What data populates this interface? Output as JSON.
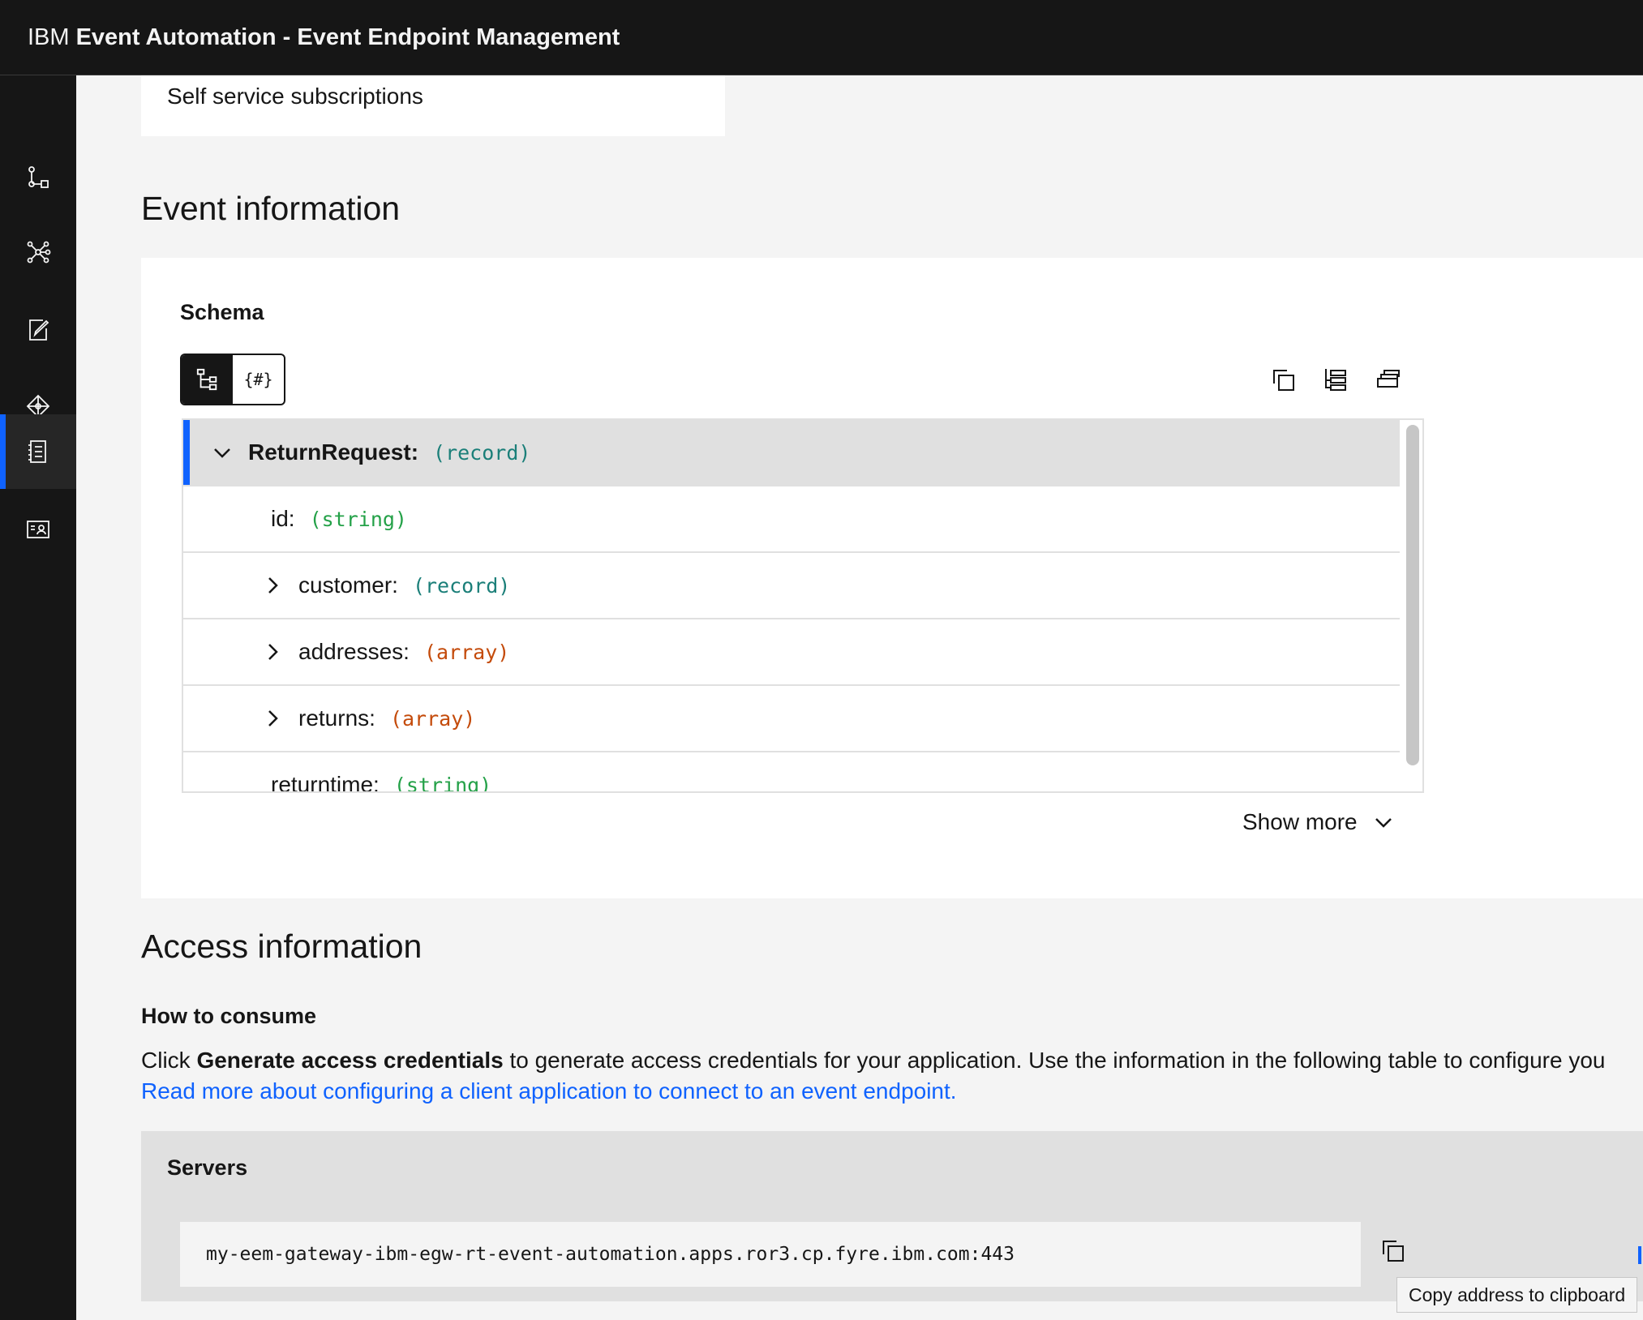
{
  "header": {
    "brand": "IBM",
    "product": "Event Automation - Event Endpoint Management"
  },
  "sidenav": {
    "items": [
      {
        "icon": "flow-icon",
        "active": false
      },
      {
        "icon": "network-icon",
        "active": false
      },
      {
        "icon": "edit-icon",
        "active": false
      },
      {
        "icon": "puzzle-icon",
        "active": false
      },
      {
        "icon": "catalog-icon",
        "active": true
      },
      {
        "icon": "contact-card-icon",
        "active": false
      }
    ]
  },
  "top_card": {
    "text": "Self service subscriptions"
  },
  "event_information": {
    "title": "Event information",
    "schema": {
      "label": "Schema",
      "view_toggle": {
        "tree_icon": "tree-view-icon",
        "json_label": "{#}"
      },
      "tools": [
        "copy-icon",
        "expand-all-icon",
        "collapse-all-icon"
      ],
      "rows": [
        {
          "name": "ReturnRequest:",
          "type": "(record)",
          "kind": "record",
          "expanded": true,
          "selected": true,
          "bold": true
        },
        {
          "name": "id:",
          "type": "(string)",
          "kind": "string",
          "expandable": false
        },
        {
          "name": "customer:",
          "type": "(record)",
          "kind": "record",
          "expandable": true
        },
        {
          "name": "addresses:",
          "type": "(array)",
          "kind": "array",
          "expandable": true
        },
        {
          "name": "returns:",
          "type": "(array)",
          "kind": "array",
          "expandable": true
        },
        {
          "name": "returntime:",
          "type": "(string)",
          "kind": "string",
          "expandable": false
        }
      ],
      "show_more": "Show more"
    }
  },
  "access_information": {
    "title": "Access information",
    "how_to_consume": "How to consume",
    "para_prefix": "Click ",
    "para_bold": "Generate access credentials",
    "para_suffix": " to generate access credentials for your application. Use the information in the following table to configure you",
    "link": "Read more about configuring a client application to connect to an event endpoint.",
    "servers": {
      "label": "Servers",
      "address": "my-eem-gateway-ibm-egw-rt-event-automation.apps.ror3.cp.fyre.ibm.com:443"
    },
    "tooltip": "Copy address to clipboard"
  },
  "colors": {
    "accent": "#0f62fe",
    "header_bg": "#161616",
    "record": "#1b7f79",
    "string": "#24a148",
    "array": "#c44b0b"
  }
}
